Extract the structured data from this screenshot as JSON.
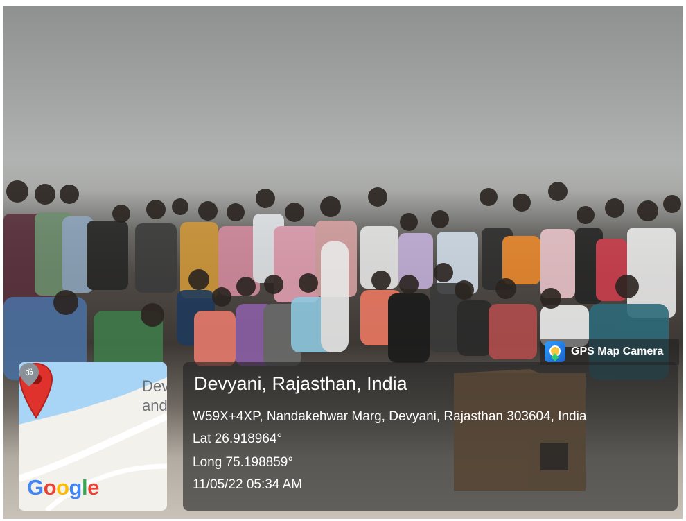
{
  "photo": {
    "scene": "group-photo"
  },
  "badge": {
    "label": "GPS Map Camera",
    "icon": "gps-map-camera-icon"
  },
  "location": {
    "title": "Devyani, Rajasthan, India",
    "address": "W59X+4XP, Nandakehwar Marg, Devyani, Rajasthan 303604, India",
    "lat": "Lat 26.918964°",
    "long": "Long 75.198859°",
    "datetime": "11/05/22 05:34 AM"
  },
  "map": {
    "label_line1": "Dev",
    "label_line2": "and",
    "brand": "Google",
    "marker_icon": "map-pin-icon",
    "poi_icon": "om-poi-icon"
  },
  "colors": {
    "pin_red": "#e0322c",
    "water_blue": "#a8d4f5",
    "google_blue": "#4285f4",
    "google_red": "#ea4335",
    "google_yellow": "#fbbc05",
    "google_green": "#34a853"
  }
}
